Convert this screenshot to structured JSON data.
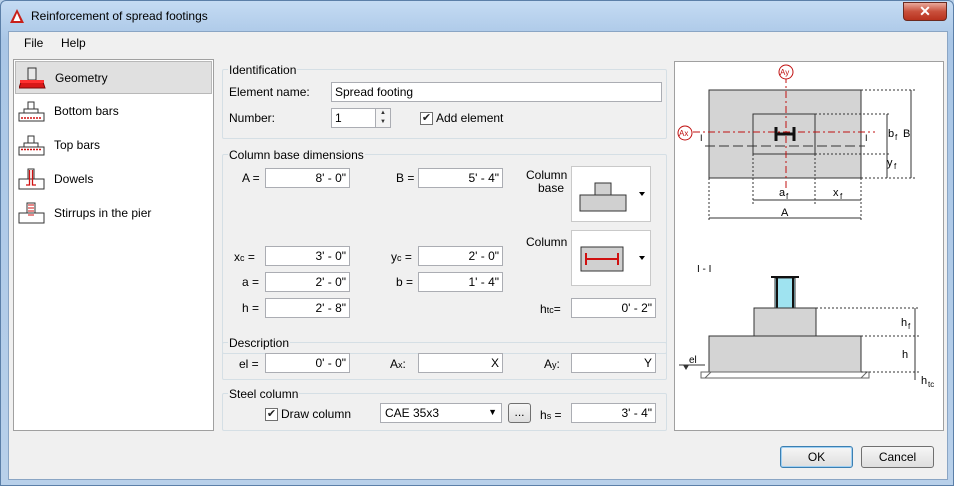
{
  "window": {
    "title": "Reinforcement of spread footings",
    "close_label": "✕"
  },
  "menu": {
    "file": "File",
    "help": "Help"
  },
  "nav": {
    "items": [
      {
        "label": "Geometry"
      },
      {
        "label": "Bottom bars"
      },
      {
        "label": "Top bars"
      },
      {
        "label": "Dowels"
      },
      {
        "label": "Stirrups in the pier"
      }
    ]
  },
  "identification": {
    "title": "Identification",
    "element_name_label": "Element name:",
    "element_name_value": "Spread footing",
    "number_label": "Number:",
    "number_value": "1",
    "add_element_label": "Add element"
  },
  "column_base": {
    "title": "Column base dimensions",
    "A_label": "A =",
    "A_value": "8' - 0\"",
    "B_label": "B =",
    "B_value": "5' - 4\"",
    "xc_label": "x",
    "xc_sub": "c",
    "xc_eq": "=",
    "xc_value": "3' - 0\"",
    "yc_label": "y",
    "yc_sub": "c",
    "yc_eq": "=",
    "yc_value": "2' - 0\"",
    "a_label": "a =",
    "a_value": "2' - 0\"",
    "b_label": "b =",
    "b_value": "1' - 4\"",
    "h_label": "h =",
    "h_value": "2' - 8\"",
    "htc_label": "h",
    "htc_sub": "tc",
    "htc_eq": "=",
    "htc_value": "0' - 2\"",
    "column_base_label_1": "Column",
    "column_base_label_2": "base",
    "column_label": "Column"
  },
  "description": {
    "title": "Description",
    "el_label": "el =",
    "el_value": "0' - 0\"",
    "ax_label": "A",
    "ax_sub": "x",
    "ax_colon": ":",
    "ax_value": "X",
    "ay_label": "A",
    "ay_sub": "y",
    "ay_colon": ":",
    "ay_value": "Y"
  },
  "steel_column": {
    "title": "Steel column",
    "draw_column_label": "Draw column",
    "profile_value": "CAE 35x3",
    "browse_label": "...",
    "hs_label": "h",
    "hs_sub": "s",
    "hs_eq": "=",
    "hs_value": "3' - 4\""
  },
  "preview": {
    "ay": "Ay",
    "ax": "Ax",
    "i1": "I",
    "i2": "I",
    "bf": "b",
    "bf_sub": "f",
    "B": "B",
    "yf": "y",
    "yf_sub": "f",
    "af": "a",
    "af_sub": "f",
    "xf": "x",
    "xf_sub": "f",
    "A": "A",
    "section": "I - I",
    "hf": "h",
    "hf_sub": "f",
    "h": "h",
    "htc": "h",
    "htc_sub": "tc",
    "el": "el"
  },
  "buttons": {
    "ok": "OK",
    "cancel": "Cancel"
  },
  "colors": {
    "accent_red": "#d01010",
    "footing_fill": "#d4d4d4",
    "column_cyan": "#9fe3f0"
  }
}
